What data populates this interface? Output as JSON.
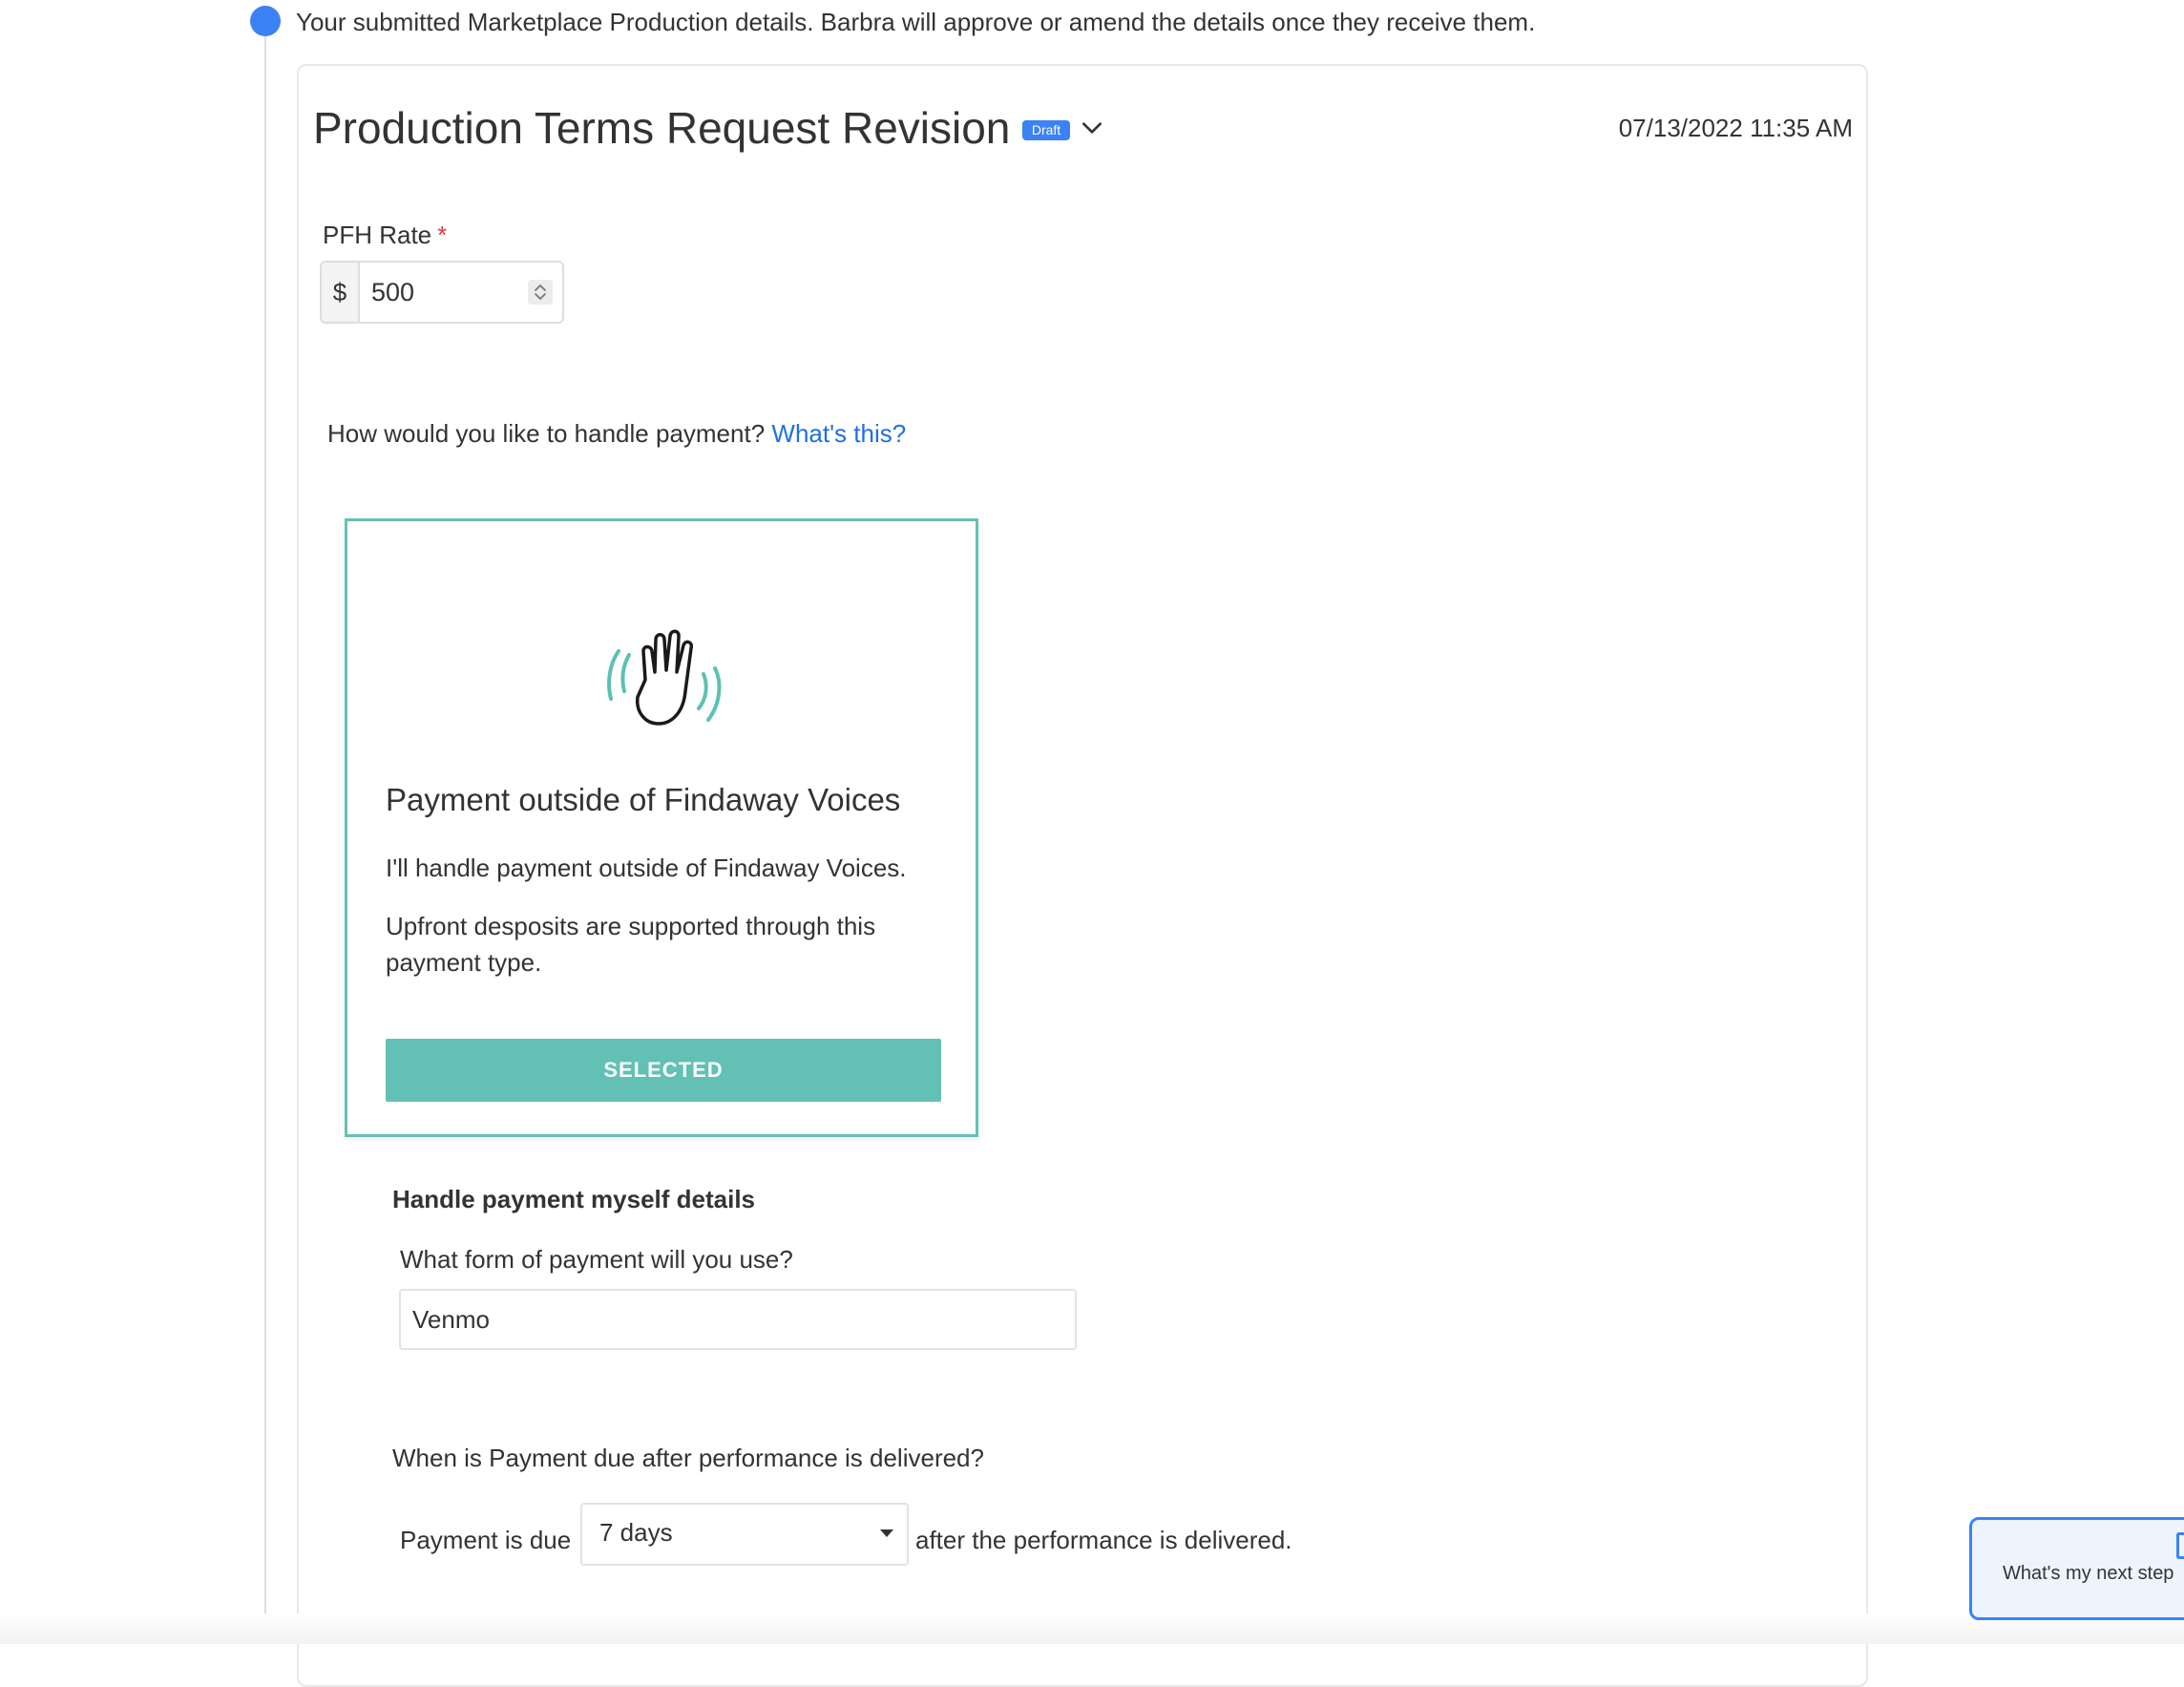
{
  "notice": {
    "text": "Your submitted Marketplace Production details. Barbra will approve or amend the details once they receive them."
  },
  "card": {
    "title": "Production Terms Request Revision",
    "badge": "Draft",
    "timestamp": "07/13/2022 11:35 AM"
  },
  "pfh_rate": {
    "label": "PFH Rate",
    "required_mark": "*",
    "currency_symbol": "$",
    "value": "500"
  },
  "payment": {
    "question": "How would you like to handle payment?",
    "help_link": "What's this?",
    "option": {
      "title": "Payment outside of Findaway Voices",
      "description_1": "I'll handle payment outside of Findaway Voices.",
      "description_2": "Upfront desposits are supported through this payment type.",
      "button_label": "SELECTED"
    }
  },
  "details": {
    "heading": "Handle payment myself details",
    "form_question": "What form of payment will you use?",
    "form_value": "Venmo",
    "due_question": "When is Payment due after performance is delivered?",
    "due_prefix": "Payment is due",
    "due_selected": "7 days",
    "due_suffix": "after the performance is delivered."
  },
  "widget": {
    "label": "What's my next step"
  },
  "colors": {
    "accent_blue": "#3b82f6",
    "link_blue": "#1e6fe3",
    "teal": "#62c1b4",
    "required_red": "#e53935"
  },
  "icons": {
    "timeline_marker": "filled-circle",
    "title_toggle": "chevron-down-icon",
    "option_illustration": "waving-hand-icon",
    "select_indicator": "caret-down-icon",
    "rate_stepper": "stepper-arrows-icon"
  }
}
